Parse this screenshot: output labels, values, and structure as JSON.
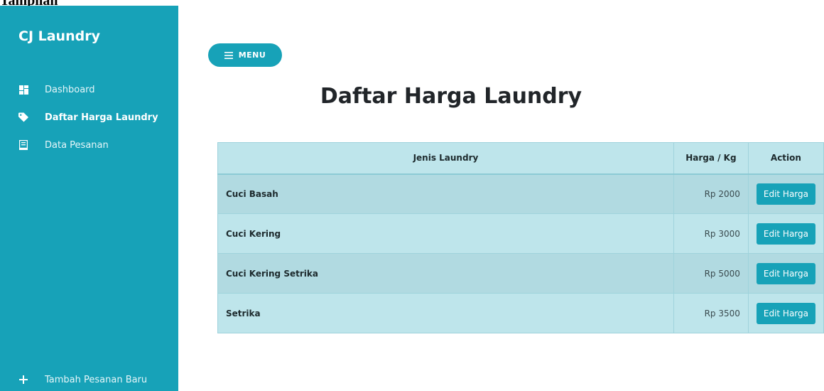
{
  "caption": "Tampilan",
  "sidebar": {
    "brand": "CJ Laundry",
    "items": [
      {
        "label": "Dashboard",
        "icon": "dashboard-icon"
      },
      {
        "label": "Daftar Harga Laundry",
        "icon": "tag-icon",
        "active": true
      },
      {
        "label": "Data Pesanan",
        "icon": "receipt-icon"
      }
    ],
    "bottom_item": {
      "label": "Tambah Pesanan Baru",
      "icon": "plus-icon"
    }
  },
  "menu_button": {
    "label": "MENU",
    "icon": "hamburger-icon"
  },
  "page_title": "Daftar Harga Laundry",
  "table": {
    "headers": [
      "Jenis Laundry",
      "Harga / Kg",
      "Action"
    ],
    "rows": [
      {
        "jenis": "Cuci Basah",
        "harga": "Rp 2000",
        "action": "Edit Harga"
      },
      {
        "jenis": "Cuci Kering",
        "harga": "Rp 3000",
        "action": "Edit Harga"
      },
      {
        "jenis": "Cuci Kering Setrika",
        "harga": "Rp 5000",
        "action": "Edit Harga"
      },
      {
        "jenis": "Setrika",
        "harga": "Rp 3500",
        "action": "Edit Harga"
      }
    ]
  },
  "colors": {
    "primary": "#17a2b8",
    "table_header": "#bee5eb",
    "table_row_alt": "#b1dae1"
  }
}
